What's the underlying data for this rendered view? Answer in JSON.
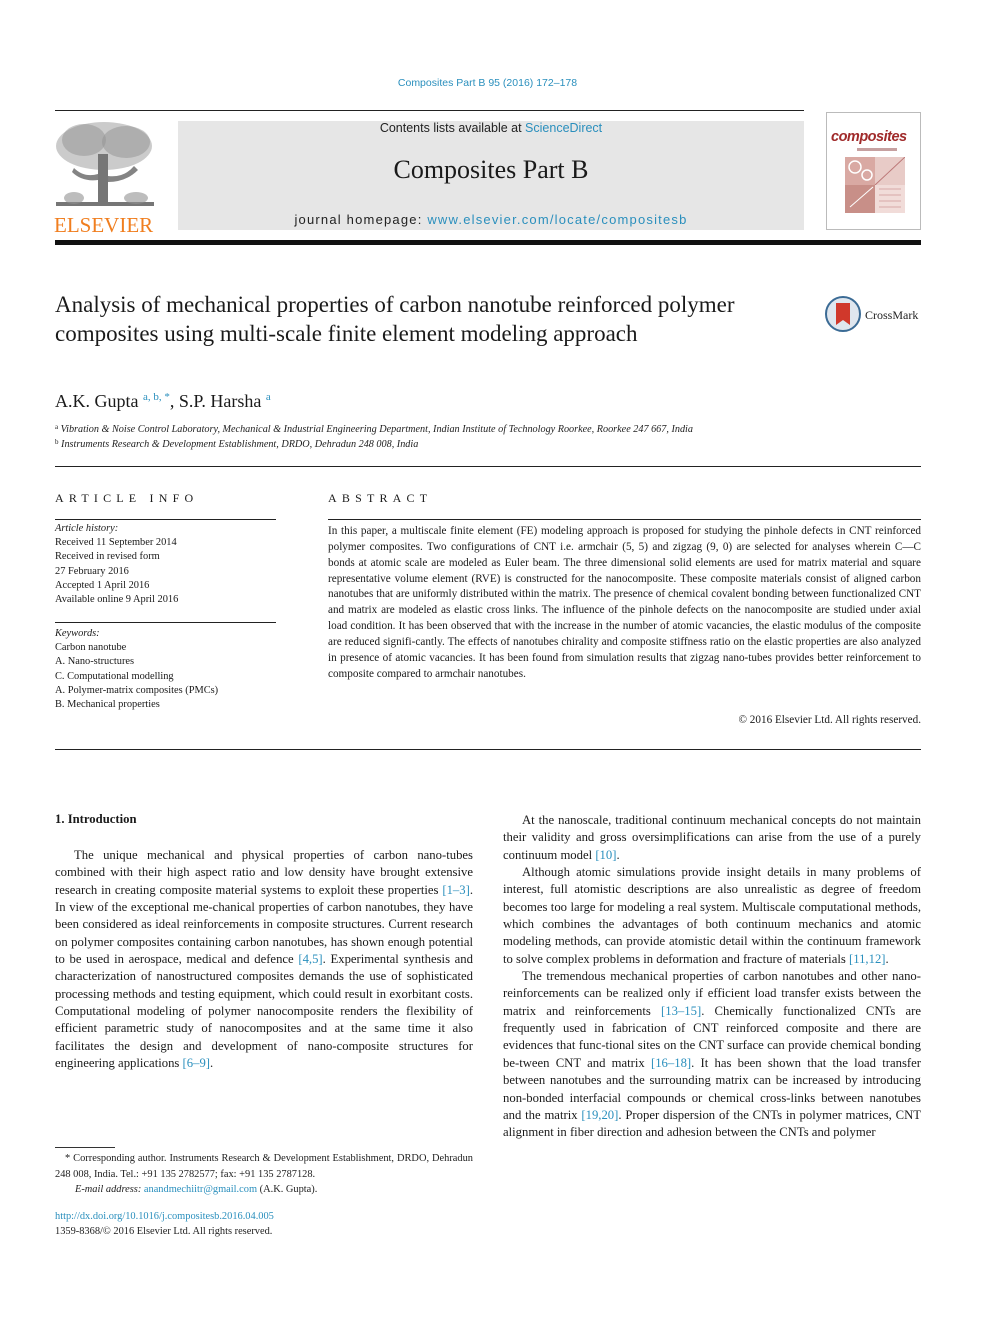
{
  "header": {
    "journal_ref": "Composites Part B 95 (2016) 172–178",
    "contents_prefix": "Contents lists available at ",
    "contents_link": "ScienceDirect",
    "journal_title": "Composites Part B",
    "homepage_prefix": "journal homepage: ",
    "homepage_link": "www.elsevier.com/locate/compositesb",
    "publisher_logo": "ELSEVIER",
    "cover_title": "composites",
    "brand_color": "#f07e1f",
    "link_color": "#2a8fbd"
  },
  "article": {
    "title": "Analysis of mechanical properties of carbon nanotube reinforced polymer composites using multi-scale finite element modeling approach",
    "crossmark_label": "CrossMark",
    "authors": [
      {
        "name": "A.K. Gupta",
        "marks": "a, b, *"
      },
      {
        "name": "S.P. Harsha",
        "marks": "a"
      }
    ],
    "author_separator": ", ",
    "affiliations": [
      {
        "mark": "a",
        "text": "Vibration & Noise Control Laboratory, Mechanical & Industrial Engineering Department, Indian Institute of Technology Roorkee, Roorkee 247 667, India"
      },
      {
        "mark": "b",
        "text": "Instruments Research & Development Establishment, DRDO, Dehradun 248 008, India"
      }
    ]
  },
  "article_info": {
    "heading": "ARTICLE INFO",
    "history_label": "Article history:",
    "history": [
      "Received 11 September 2014",
      "Received in revised form",
      "27 February 2016",
      "Accepted 1 April 2016",
      "Available online 9 April 2016"
    ],
    "keywords_label": "Keywords:",
    "keywords": [
      "Carbon nanotube",
      "A. Nano-structures",
      "C. Computational modelling",
      "A. Polymer-matrix composites (PMCs)",
      "B. Mechanical properties"
    ]
  },
  "abstract": {
    "heading": "ABSTRACT",
    "text": "In this paper, a multiscale finite element (FE) modeling approach is proposed for studying the pinhole defects in CNT reinforced polymer composites. Two configurations of CNT i.e. armchair (5, 5) and zigzag (9, 0) are selected for analyses wherein C—C bonds at atomic scale are modeled as Euler beam. The three dimensional solid elements are used for matrix material and square representative volume element (RVE) is constructed for the nanocomposite. These composite materials consist of aligned carbon nanotubes that are uniformly distributed within the matrix. The presence of chemical covalent bonding between functionalized CNT and matrix are modeled as elastic cross links. The influence of the pinhole defects on the nanocomposite are studied under axial load condition. It has been observed that with the increase in the number of atomic vacancies, the elastic modulus of the composite are reduced signifi-cantly. The effects of nanotubes chirality and composite stiffness ratio on the elastic properties are also analyzed in presence of atomic vacancies. It has been found from simulation results that zigzag nano-tubes provides better reinforcement to composite compared to armchair nanotubes.",
    "copyright": "© 2016 Elsevier Ltd. All rights reserved."
  },
  "body": {
    "section_heading": "1.  Introduction",
    "left_paragraphs": [
      [
        {
          "t": "The unique mechanical and physical properties of carbon nano-tubes combined with their high aspect ratio and low density have brought extensive research in creating composite material systems to exploit these properties "
        },
        {
          "ref": "[1–3]"
        },
        {
          "t": ". In view of the exceptional me-chanical properties of carbon nanotubes, they have been considered as ideal reinforcements in composite structures. Current research on polymer composites containing carbon nanotubes, has shown enough potential to be used in aerospace, medical and defence "
        },
        {
          "ref": "[4,5]"
        },
        {
          "t": ". Experimental synthesis and characterization of nanostructured composites demands the use of sophisticated processing methods and testing equipment, which could result in exorbitant costs. Computational modeling of polymer nanocomposite renders the flexibility of efficient parametric study of nanocomposites and at the same time it also facilitates the design and development of nano-composite structures for engineering applications "
        },
        {
          "ref": "[6–9]"
        },
        {
          "t": "."
        }
      ]
    ],
    "right_paragraphs": [
      [
        {
          "t": "At the nanoscale, traditional continuum mechanical concepts do not maintain their validity and gross oversimplifications can arise from the use of a purely continuum model "
        },
        {
          "ref": "[10]"
        },
        {
          "t": "."
        }
      ],
      [
        {
          "t": "Although atomic simulations provide insight details in many problems of interest, full atomistic descriptions are also unrealistic as degree of freedom becomes too large for modeling a real system. Multiscale computational methods, which combines the advantages of both continuum mechanics and atomic modeling methods, can provide atomistic detail within the continuum framework to solve complex problems in deformation and fracture of materials "
        },
        {
          "ref": "[11,12]"
        },
        {
          "t": "."
        }
      ],
      [
        {
          "t": "The tremendous mechanical properties of carbon nanotubes and other nano-reinforcements can be realized only if efficient load transfer exists between the matrix and reinforcements "
        },
        {
          "ref": "[13–15]"
        },
        {
          "t": ". Chemically functionalized CNTs are frequently used in fabrication of CNT reinforced composite and there are evidences that func-tional sites on the CNT surface can provide chemical bonding be-tween CNT and matrix "
        },
        {
          "ref": "[16–18]"
        },
        {
          "t": ". It has been shown that the load transfer between nanotubes and the surrounding matrix can be increased by introducing non-bonded interfacial compounds or chemical cross-links between nanotubes and the matrix "
        },
        {
          "ref": "[19,20]"
        },
        {
          "t": ". Proper dispersion of the CNTs in polymer matrices, CNT alignment in fiber direction and adhesion between the CNTs and polymer"
        }
      ]
    ]
  },
  "footnotes": {
    "corresponding": "* Corresponding author. Instruments Research & Development Establishment, DRDO, Dehradun 248 008, India. Tel.: +91 135 2782577; fax: +91 135 2787128.",
    "email_label": "E-mail address: ",
    "email": "anandmechiitr@gmail.com",
    "email_suffix": " (A.K. Gupta).",
    "doi": "http://dx.doi.org/10.1016/j.compositesb.2016.04.005",
    "issn": "1359-8368/© 2016 Elsevier Ltd. All rights reserved."
  }
}
